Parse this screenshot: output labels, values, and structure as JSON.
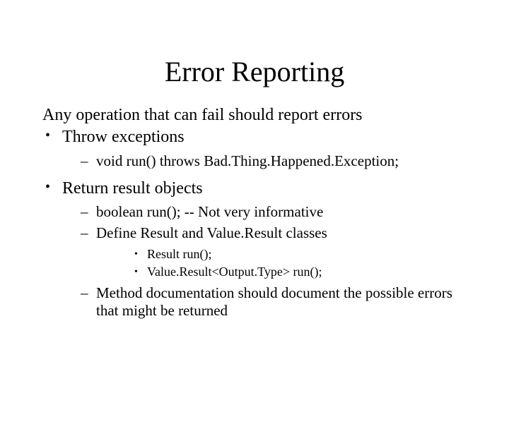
{
  "title": "Error Reporting",
  "intro": "Any operation that can fail should report errors",
  "bullets": {
    "b1": "Throw exceptions",
    "b1_s1": "void run() throws Bad.Thing.Happened.Exception;",
    "b2": "Return result objects",
    "b2_s1": "boolean run(); -- Not very informative",
    "b2_s2": "Define Result and Value.Result classes",
    "b2_s2_i1": "Result run();",
    "b2_s2_i2": "Value.Result<Output.Type> run();",
    "b2_s3": "Method documentation should document the possible errors that might be returned"
  }
}
